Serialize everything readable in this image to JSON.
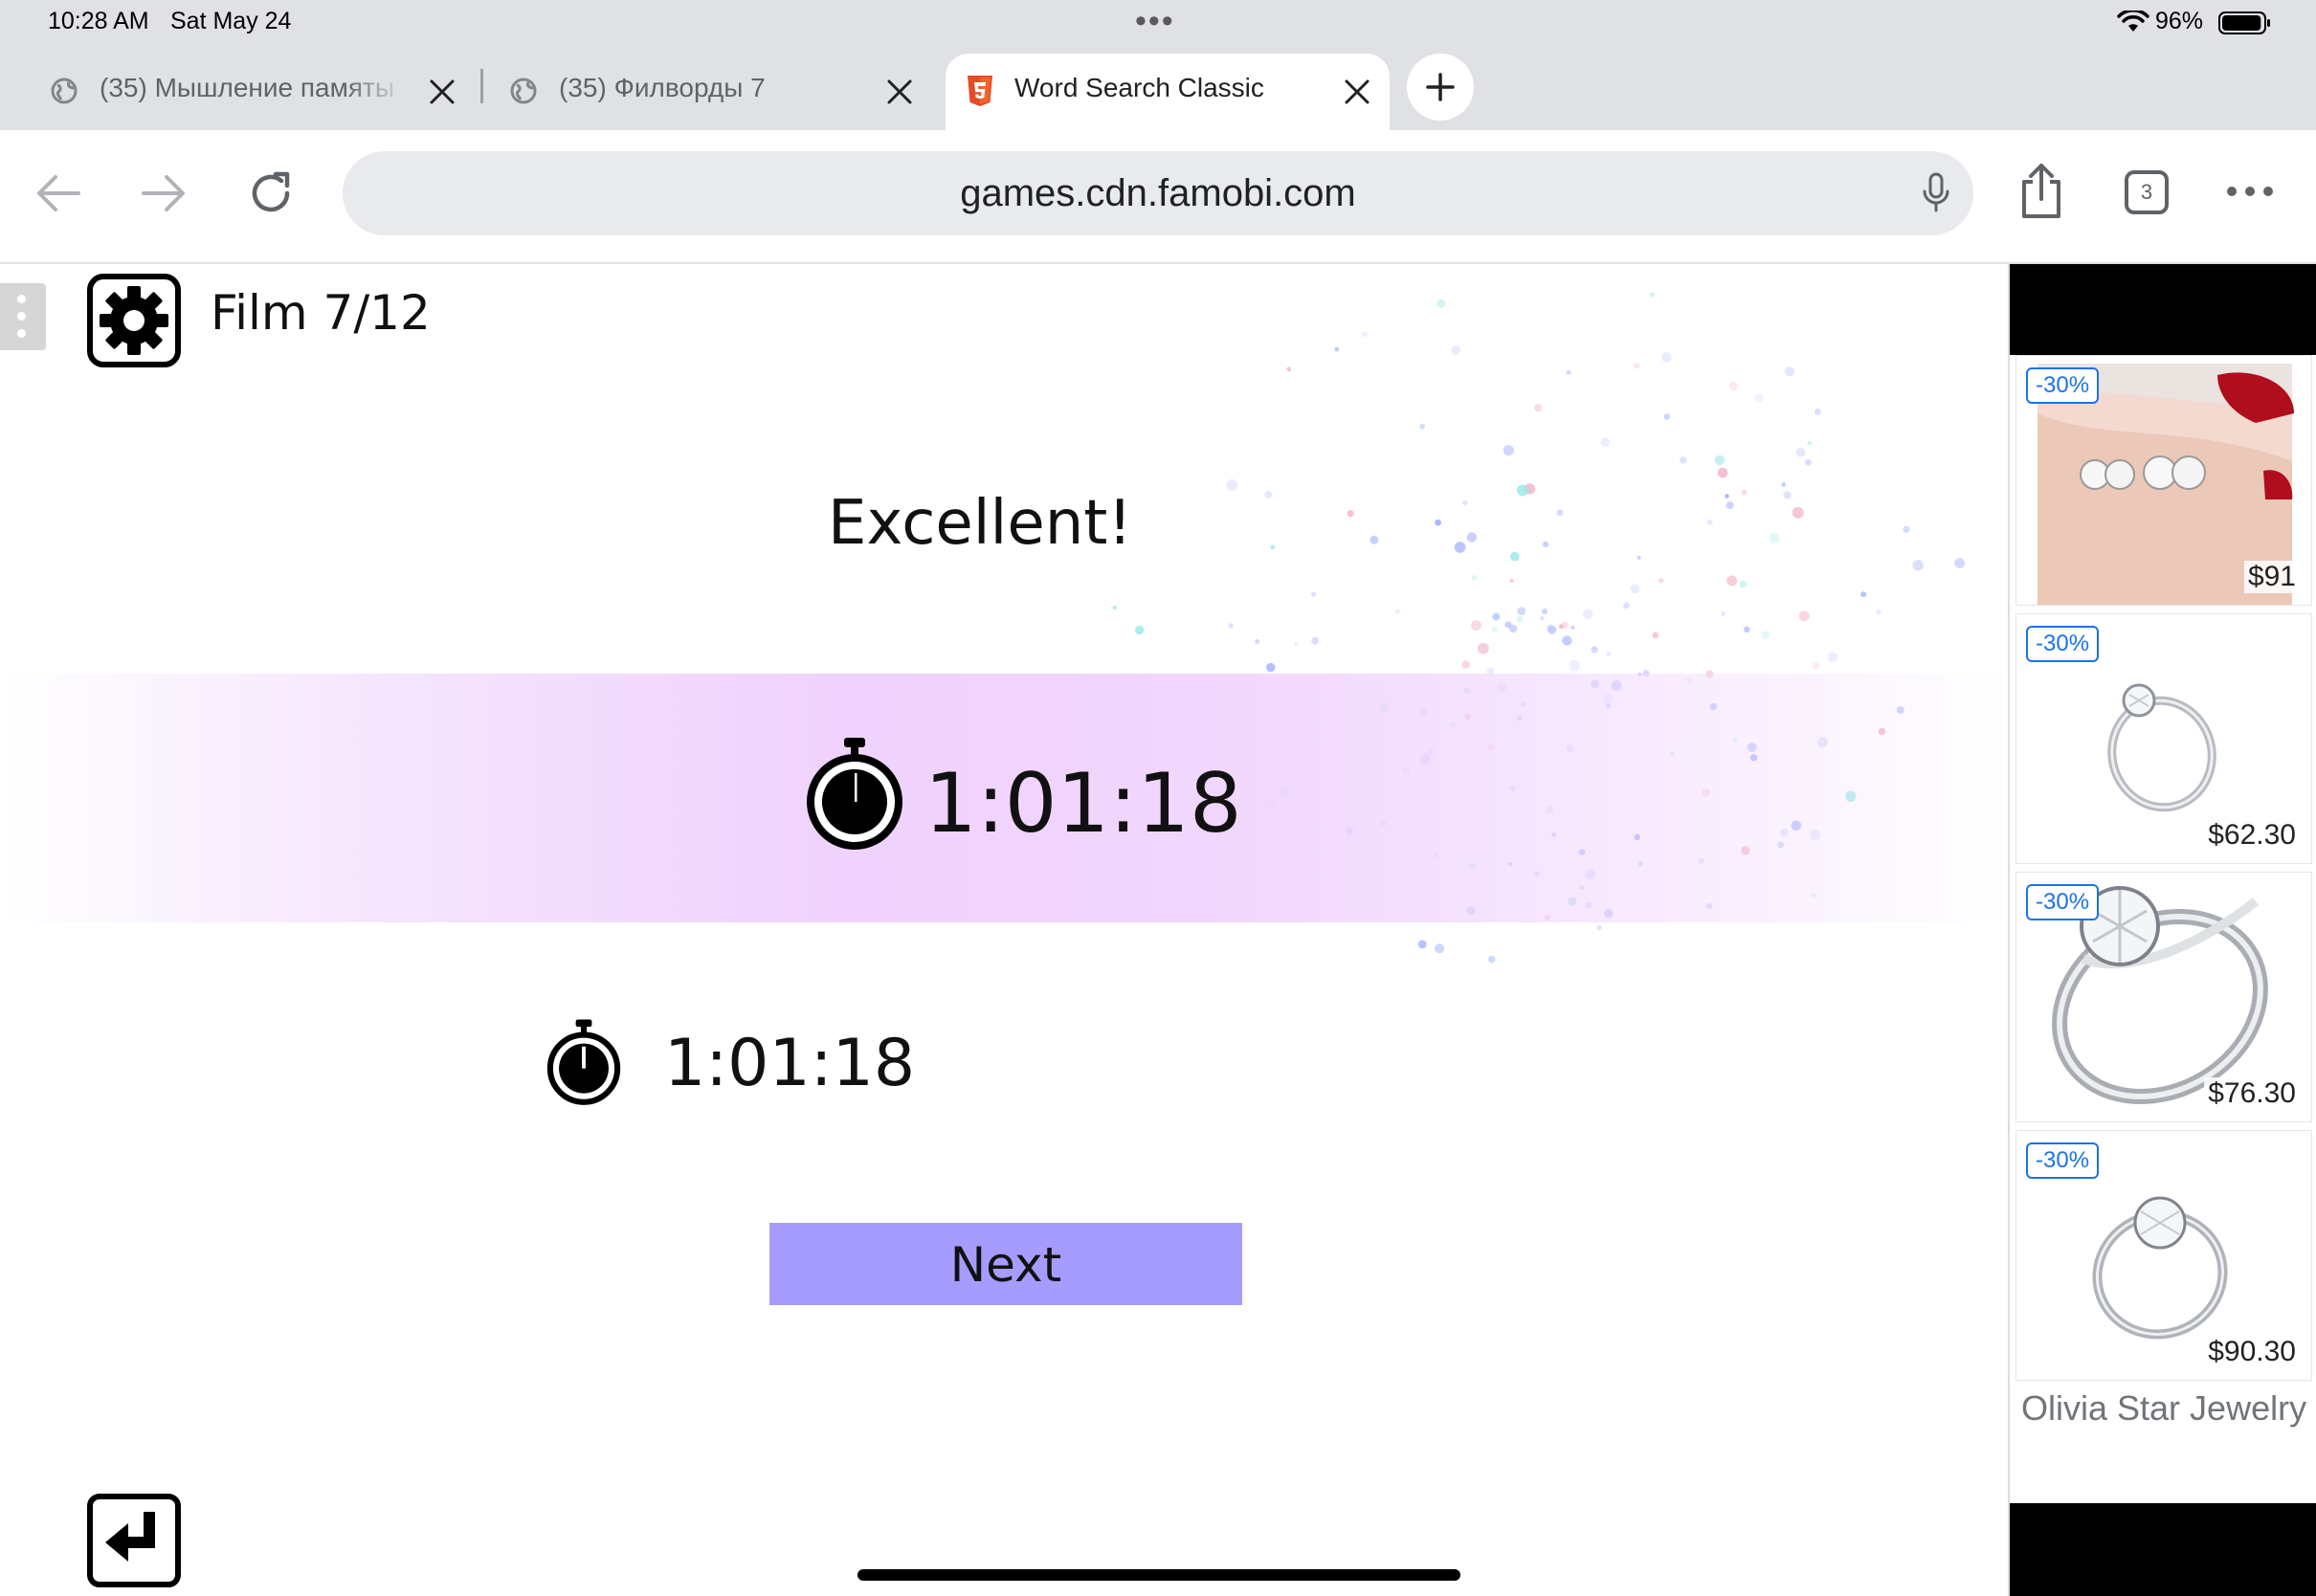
{
  "status_bar": {
    "time": "10:28 AM",
    "date": "Sat May 24",
    "battery_percent": "96%",
    "battery_level": 0.96,
    "dots": "•••"
  },
  "tabs": [
    {
      "title": "(35) Мышление памяты",
      "icon": "globe-icon",
      "active": false
    },
    {
      "title": "(35) Филворды 7",
      "icon": "globe-icon",
      "active": false
    },
    {
      "title": "Word Search Classic",
      "icon": "html5-icon",
      "active": true
    }
  ],
  "toolbar": {
    "url": "games.cdn.famobi.com",
    "tab_count": "3"
  },
  "game": {
    "level_label": "Film 7/12",
    "headline": "Excellent!",
    "current_time": "1:01:18",
    "best_time": "1:01:18",
    "next_label": "Next"
  },
  "ads": {
    "items": [
      {
        "discount": "-30%",
        "price": "$91",
        "product": "earrings"
      },
      {
        "discount": "-30%",
        "price": "$62.30",
        "product": "ring"
      },
      {
        "discount": "-30%",
        "price": "$76.30",
        "product": "ring"
      },
      {
        "discount": "-30%",
        "price": "$90.30",
        "product": "ring"
      }
    ],
    "advertiser": "Olivia Star Jewelry"
  },
  "colors": {
    "chrome_bg": "#dfe1e5",
    "band_purple": "#efd2fd",
    "next_button": "#a69cff",
    "badge_blue": "#1a73e8"
  }
}
